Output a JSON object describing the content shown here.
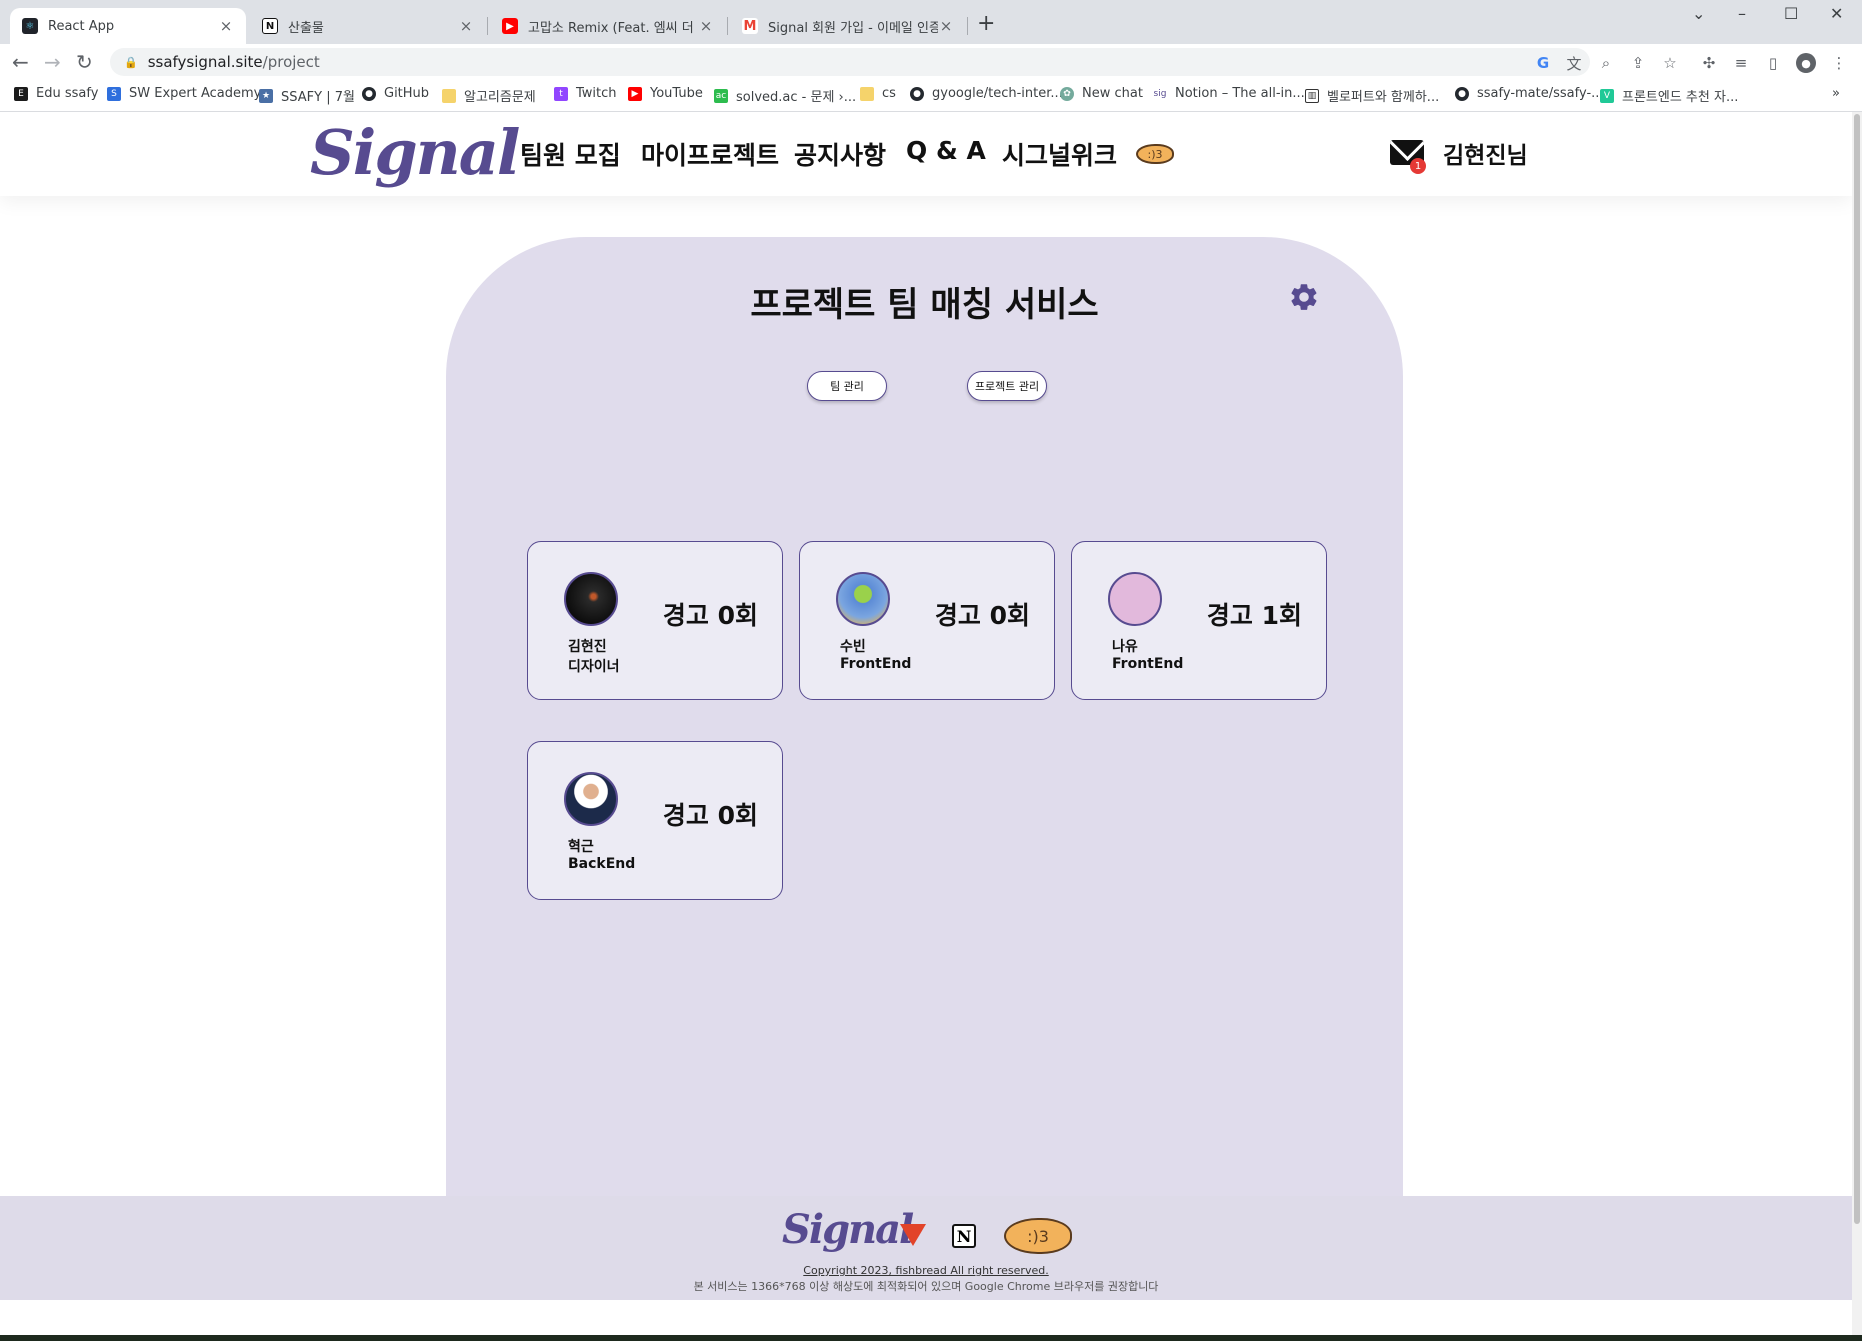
{
  "browser": {
    "tabs": [
      {
        "title": "React App",
        "active": true
      },
      {
        "title": "산출물",
        "active": false
      },
      {
        "title": "고맙소 Remix (Feat. 엠씨 더 항기",
        "active": false
      },
      {
        "title": "Signal 회원 가입 - 이메일 인증",
        "active": false
      }
    ],
    "new_tab": "+",
    "url_host": "ssafysignal.site",
    "url_path": "/project",
    "bookmarks": [
      "Edu ssafy",
      "SW Expert Academy",
      "SSAFY | 7월",
      "GitHub",
      "알고리즘문제",
      "Twitch",
      "YouTube",
      "solved.ac - 문제 ›...",
      "cs",
      "gyoogle/tech-inter...",
      "New chat",
      "Notion – The all-in...",
      "벨로퍼트와 함께하...",
      "ssafy-mate/ssafy-...",
      "프론트엔드 추천 자..."
    ],
    "bookmarks_more": "»"
  },
  "header": {
    "logo": "Signal",
    "nav": [
      "팀원 모집",
      "마이프로젝트",
      "공지사항",
      "Q & A",
      "시그널위크"
    ],
    "mail_badge": "1",
    "username": "김현진님"
  },
  "panel": {
    "title": "프로젝트 팀 매칭 서비스",
    "buttons": [
      "팀 관리",
      "프로젝트 관리"
    ]
  },
  "members": [
    {
      "name": "김현진",
      "role": "디자이너",
      "warning": "경고 0회"
    },
    {
      "name": "수빈",
      "role": "FrontEnd",
      "warning": "경고 0회"
    },
    {
      "name": "나유",
      "role": "FrontEnd",
      "warning": "경고 1회"
    },
    {
      "name": "혁근",
      "role": "BackEnd",
      "warning": "경고 0회"
    }
  ],
  "footer": {
    "logo": "Signal",
    "copyright": "Copyright 2023, fishbread All right reserved.",
    "notice": "본 서비스는 1366*768 이상 해상도에 최적화되어 있으며 Google Chrome 브라우저를 권장합니다"
  },
  "colors": {
    "brand": "#574b90",
    "panel": "#e0dcec",
    "card": "#ecebf4",
    "badge": "#e53935"
  }
}
